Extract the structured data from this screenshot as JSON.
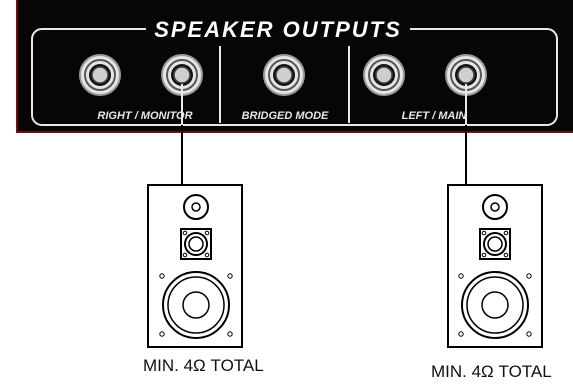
{
  "panel": {
    "title": "SPEAKER OUTPUTS",
    "sections": [
      {
        "label": "RIGHT / MONITOR"
      },
      {
        "label": "BRIDGED MODE"
      },
      {
        "label": "LEFT / MAIN"
      }
    ]
  },
  "speakers": [
    {
      "spec": "MIN. 4Ω TOTAL"
    },
    {
      "spec": "MIN. 4Ω TOTAL"
    }
  ]
}
